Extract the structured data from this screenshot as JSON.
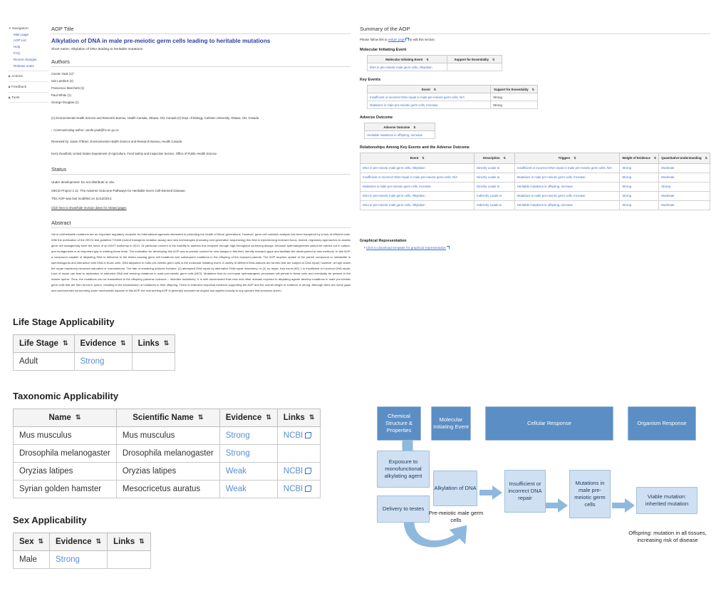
{
  "sidebar": {
    "groups": [
      {
        "label": "Navigation",
        "expanded": true,
        "items": [
          "Main page",
          "AOP List",
          "Help",
          "FAQ",
          "Recent changes",
          "Release notes"
        ]
      },
      {
        "label": "Actions",
        "expanded": false,
        "items": []
      },
      {
        "label": "Feedback",
        "expanded": false,
        "items": []
      },
      {
        "label": "Tools",
        "expanded": false,
        "items": []
      }
    ]
  },
  "aop": {
    "section_label": "AOP Title",
    "title": "Alkylation of DNA in male pre-meiotic germ cells leading to heritable mutations",
    "short_name": "Short name: Alkylation of DNA leading to heritable mutations"
  },
  "authors": {
    "heading": "Authors",
    "list": [
      "Carole Yauk (1)*",
      "Iain Lambert (2)",
      "Francesco Marchetti (1)",
      "Paul White (1)",
      "George Douglas (1)"
    ],
    "affiliations": "(1) Environmental Health Science and Research Bureau, Health Canada, Ottawa, ON, Canada (2) Dept. of Biology, Carleton University, Ottawa, ON, Canada",
    "corresponding": "Communicating author: carole.yauk@hc-sc.gc.ca",
    "reviewers": [
      "Reviewed by: Jason O'Brien, Environmental Health Science and Research Bureau, Health Canada",
      "Kerry Dearfield, United States Department of Agriculture, Food Safety and Inspection Service, Office of Public Health Science"
    ]
  },
  "status": {
    "heading": "Status",
    "lines": [
      "Under development: Do not distribute or cite.",
      "OECD Project 1.11: The Adverse Outcome Pathways for Heritable Germ Cell-Derived Disease.",
      "This AOP was last modified on 11/12/2014."
    ],
    "revision_link": "Click here to show/hide revision dates for related pages"
  },
  "abstract": {
    "heading": "Abstract",
    "body": "Germ cell/heritable mutations are an important regulatory endpoint for international agencies interested in protecting the health of future generations. However, germ cell mutation analysis has been hampered by a lack of efficient tools. With the publication of the OECD test guideline TG488 (rodent transgenic mutation assay) and new technologies (including next generation sequencing) this field is experiencing renewed focus. Indeed, regulatory approaches to assess germ cell mutagenicity were the focus of an IWGT workshop in 2013. Of particular concern is the inability to address this endpoint through high-throughput screening assays, because spermatogenesis cannot be carried out in culture, and mutagenesis is an important gap in existing these tests. The motivation for developing this AOP was to provide context for new assays in this field, identify research gaps and facilitate the development of new methods. In this AOP, a compound capable of alkylating DNA is delivered to the testes causing germ cell mutations and subsequent mutations in the offspring of the exposed parents. The AOP requires uptake of the parent compound or metabolite in spermatogonia and interaction with DNA in those cells. DNA alkylation in male pre-meiotic germ cells is the molecular initiating event. A variety of different DNA adducts are formed that are subject to DNA repair; however, at high doses the repair machinery becomes saturated or overwhelmed. The fate of remaining adducts includes: (1) attempted DNA repair by alternative DNA repair machinery, or (2) no repair. Key event (KE) 1 is insufficient or incorrect DNA repair. Lack of repair can lead to replication of adducted DNA and ensuing mutations in male pre-meiotic germ cells (KE2). Mutations that do not impair spermatogenic processes will persist in these cells and eventually be present in the mature sperm. Thus, the mutations can be transmitted to the offspring (adverse outcome – inherited mutations). It is well documented that mice and other animals exposed to alkylating agents develop mutations in male pre-meiotic germ cells that are then found in sperm, resulting in the transmission of mutations to their offspring. There is extensive empirical evidence supporting the AOP and the overall weight of evidence is strong. Although there are some gaps and controversies surrounding some mechanistic aspects of this AOP, the overarching AOP is generally accepted as dogma and applies broadly to any species that produces sperm."
  },
  "summary": {
    "heading": "Summary of the AOP",
    "note_prefix": "Please follow link to ",
    "note_link": "widget page",
    "note_suffix": " to edit this section.",
    "mie": {
      "heading": "Molecular Initiating Event",
      "columns": [
        "Molecular Initiating Event",
        "Support for Essentiality"
      ],
      "rows": [
        {
          "event": "DNA in pre-meiotic male germ cells, Alkylation",
          "support": ""
        }
      ]
    },
    "key_events": {
      "heading": "Key Events",
      "columns": [
        "Event",
        "Support for Essentiality"
      ],
      "rows": [
        {
          "event": "Insufficient or incorrect DNA repair in male pre-meiotic germ cells, N/A",
          "support": "Strong"
        },
        {
          "event": "Mutations in male pre-meiotic germ cells, Increase",
          "support": "Strong"
        }
      ]
    },
    "adverse_outcome": {
      "heading": "Adverse Outcome",
      "columns": [
        "Adverse Outcome"
      ],
      "rows": [
        {
          "outcome": "Heritable mutations in offspring, Increase"
        }
      ]
    },
    "relationships": {
      "heading": "Relationships Among Key Events and the Adverse Outcome",
      "columns": [
        "Event",
        "Description",
        "Triggers",
        "Weight of Evidence",
        "Quantitative Understanding"
      ],
      "rows": [
        {
          "event": "DNA in pre-meiotic male germ cells, Alkylation",
          "description": "Directly Leads to",
          "triggers": "Insufficient or incorrect DNA repair in male pre-meiotic germ cells, N/A",
          "weight": "Strong",
          "quant": "Moderate"
        },
        {
          "event": "Insufficient or incorrect DNA repair in male pre-meiotic germ cells, N/A",
          "description": "Directly Leads to",
          "triggers": "Mutations in male pre-meiotic germ cells, Increase",
          "weight": "Strong",
          "quant": "Moderate"
        },
        {
          "event": "Mutations in male pre-meiotic germ cells, Increase",
          "description": "Directly Leads to",
          "triggers": "Heritable mutations in offspring, Increase",
          "weight": "Strong",
          "quant": "Strong"
        },
        {
          "event": "DNA in pre-meiotic male germ cells, Alkylation",
          "description": "Indirectly Leads to",
          "triggers": "Mutations in male pre-meiotic germ cells, Increase",
          "weight": "Strong",
          "quant": "Moderate"
        },
        {
          "event": "DNA in pre-meiotic male germ cells, Alkylation",
          "description": "Indirectly Leads to",
          "triggers": "Heritable mutations in offspring, Increase",
          "weight": "Strong",
          "quant": "Moderate"
        }
      ]
    }
  },
  "graphical": {
    "heading": "Graphical Representation",
    "link": "Click to download template for graphical representation"
  },
  "life_stage": {
    "heading": "Life Stage Applicability",
    "columns": [
      "Life Stage",
      "Evidence",
      "Links"
    ],
    "rows": [
      {
        "stage": "Adult",
        "evidence": "Strong",
        "links": ""
      }
    ]
  },
  "taxonomic": {
    "heading": "Taxonomic Applicability",
    "columns": [
      "Name",
      "Scientific Name",
      "Evidence",
      "Links"
    ],
    "rows": [
      {
        "name": "Mus musculus",
        "scientific": "Mus musculus",
        "evidence": "Strong",
        "links": "NCBI"
      },
      {
        "name": "Drosophila melanogaster",
        "scientific": "Drosophila melanogaster",
        "evidence": "Strong",
        "links": ""
      },
      {
        "name": "Oryzias latipes",
        "scientific": "Oryzias latipes",
        "evidence": "Weak",
        "links": "NCBI"
      },
      {
        "name": "Syrian golden hamster",
        "scientific": "Mesocricetus auratus",
        "evidence": "Weak",
        "links": "NCBI"
      }
    ]
  },
  "sex": {
    "heading": "Sex Applicability",
    "columns": [
      "Sex",
      "Evidence",
      "Links"
    ],
    "rows": [
      {
        "sex": "Male",
        "evidence": "Strong",
        "links": ""
      }
    ]
  },
  "diagram": {
    "headers": [
      "Chemical Structure & Properties",
      "Molecular Initiating Event",
      "Cellular Response",
      "Organism Response"
    ],
    "nodes": [
      "Exposure to monofunctional alkylating agent",
      "Delivery to testes",
      "Alkylation of DNA",
      "Insufficient or incorrect DNA repair",
      "Mutations in male pre-meiotic germ cells",
      "Viable mutation: inherited mutation"
    ],
    "captions": [
      "Pre-meiotic male germ cells",
      "Offspring: mutation in all tissues, increasing risk of disease"
    ]
  },
  "colors": {
    "link": "#3b6fd1",
    "title": "#2f3fa8",
    "diagram_header": "#5b8ec4",
    "diagram_node": "#cfe0f2",
    "arrow": "#8fb8dd"
  }
}
